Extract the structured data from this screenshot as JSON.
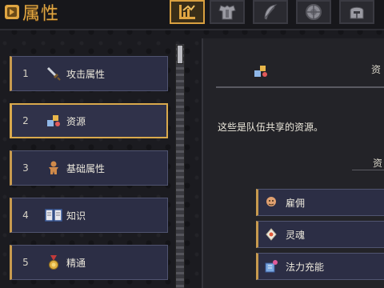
{
  "header": {
    "title": "属性",
    "tabs": [
      {
        "icon": "chart-icon",
        "active": true
      },
      {
        "icon": "armor-icon",
        "active": false
      },
      {
        "icon": "feather-icon",
        "active": false
      },
      {
        "icon": "shield-icon",
        "active": false
      },
      {
        "icon": "helmet-icon",
        "active": false
      }
    ]
  },
  "sidebar": {
    "items": [
      {
        "num": "1",
        "label": "攻击属性",
        "icon": "sword-icon"
      },
      {
        "num": "2",
        "label": "资源",
        "icon": "resources-icon"
      },
      {
        "num": "3",
        "label": "基础属性",
        "icon": "gingerbread-icon"
      },
      {
        "num": "4",
        "label": "知识",
        "icon": "book-icon"
      },
      {
        "num": "5",
        "label": "精通",
        "icon": "medal-icon"
      }
    ]
  },
  "detail": {
    "heading": "资",
    "description": "这些是队伍共享的资源。",
    "subheading": "资",
    "resources": [
      {
        "label": "雇佣",
        "icon": "face-icon"
      },
      {
        "label": "灵魂",
        "icon": "soul-icon"
      },
      {
        "label": "法力充能",
        "icon": "mana-icon"
      }
    ]
  },
  "colors": {
    "accent": "#d9a94c",
    "item_bg": "#2c2e45",
    "title": "#e0a642"
  }
}
